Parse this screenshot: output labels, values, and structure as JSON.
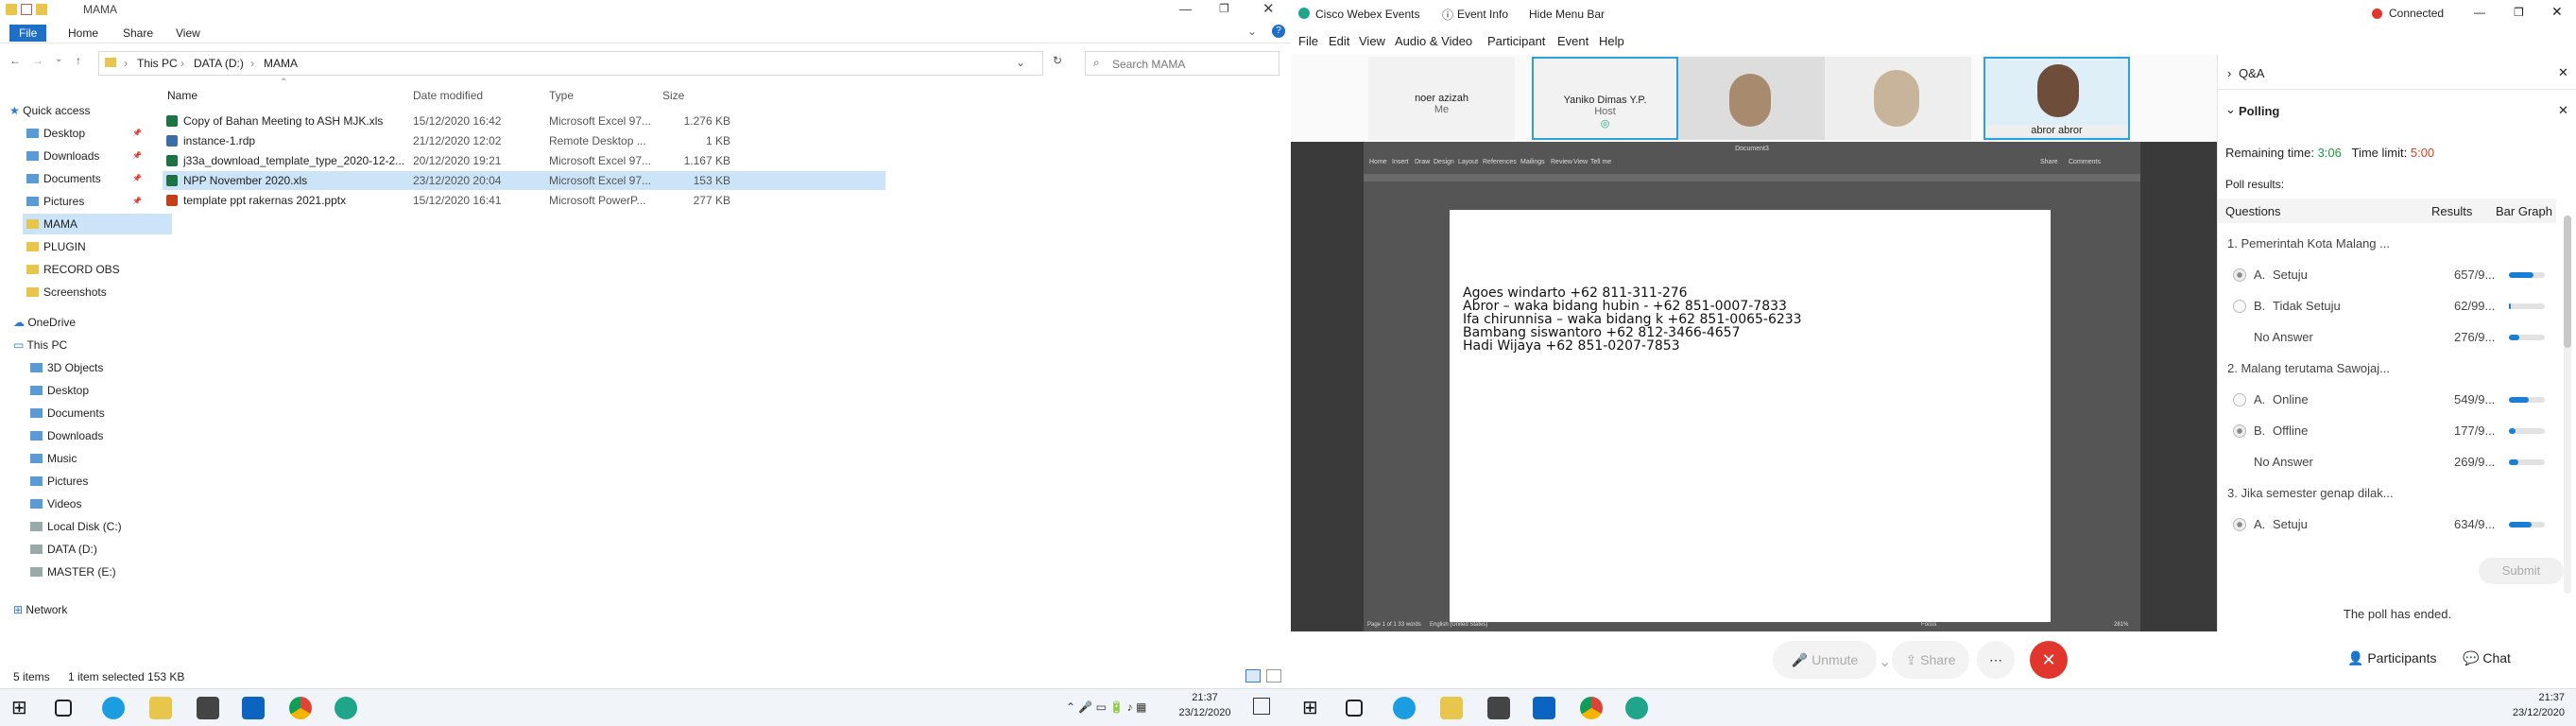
{
  "explorer": {
    "title": "MAMA",
    "ribbon_tabs": [
      "File",
      "Home",
      "Share",
      "View"
    ],
    "breadcrumb": [
      "This PC",
      "DATA (D:)",
      "MAMA"
    ],
    "search_placeholder": "Search MAMA",
    "columns": [
      "Name",
      "Date modified",
      "Type",
      "Size"
    ],
    "nav": {
      "quick_access": "Quick access",
      "quick_items": [
        "Desktop",
        "Downloads",
        "Documents",
        "Pictures",
        "MAMA",
        "PLUGIN",
        "RECORD OBS",
        "Screenshots"
      ],
      "onedrive": "OneDrive",
      "this_pc": "This PC",
      "pc_items": [
        "3D Objects",
        "Desktop",
        "Documents",
        "Downloads",
        "Music",
        "Pictures",
        "Videos",
        "Local Disk (C:)",
        "DATA (D:)",
        "MASTER (E:)"
      ],
      "network": "Network"
    },
    "files": [
      {
        "name": "Copy of Bahan Meeting to ASH MJK.xls",
        "date": "15/12/2020 16:42",
        "type": "Microsoft Excel 97...",
        "size": "1.276 KB",
        "icon": "excel-icon",
        "color": "#1f7244"
      },
      {
        "name": "instance-1.rdp",
        "date": "21/12/2020 12:02",
        "type": "Remote Desktop ...",
        "size": "1 KB",
        "icon": "rdp-icon",
        "color": "#3a6ea5"
      },
      {
        "name": "j33a_download_template_type_2020-12-2...",
        "date": "20/12/2020 19:21",
        "type": "Microsoft Excel 97...",
        "size": "1.167 KB",
        "icon": "excel-icon",
        "color": "#1f7244"
      },
      {
        "name": "NPP November 2020.xls",
        "date": "23/12/2020 20:04",
        "type": "Microsoft Excel 97...",
        "size": "153 KB",
        "icon": "excel-icon",
        "color": "#1f7244"
      },
      {
        "name": "template ppt rakernas 2021.pptx",
        "date": "15/12/2020 16:41",
        "type": "Microsoft PowerP...",
        "size": "277 KB",
        "icon": "powerpoint-icon",
        "color": "#c43e1c"
      }
    ],
    "status": {
      "items": "5 items",
      "selected": "1 item selected  153 KB"
    }
  },
  "webex": {
    "app_title": "Cisco Webex Events",
    "event_info": "Event Info",
    "hide_menu": "Hide Menu Bar",
    "connected": "Connected",
    "menu": [
      "File",
      "Edit",
      "View",
      "Audio & Video",
      "Participant",
      "Event",
      "Help"
    ],
    "participants": [
      {
        "name": "noer azizah",
        "role": "Me"
      },
      {
        "name": "Yaniko Dimas Y.P.",
        "role": "Host"
      },
      {
        "name": "abror abror",
        "role": ""
      }
    ],
    "word": {
      "doc_title": "Document3",
      "tabs": [
        "Home",
        "Insert",
        "Draw",
        "Design",
        "Layout",
        "References",
        "Mailings",
        "Review",
        "View",
        "Tell me"
      ],
      "share": "Share",
      "comments": "Comments",
      "status_left": "Page 1 of 1    33 words",
      "language": "English (United States)",
      "zoom": "281%",
      "focus": "Focus",
      "lines": [
        "Agoes windarto +62 811-311-276",
        "Abror – waka bidang hubin - +62 851-0007-7833",
        "Ifa chirunnisa – waka bidang k +62 851-0065-6233",
        "Bambang siswantoro +62 812-3466-4657",
        "Hadi Wijaya +62 851-0207-7853"
      ]
    },
    "controls": {
      "unmute": "Unmute",
      "share": "Share",
      "participants": "Participants",
      "chat": "Chat"
    },
    "panel": {
      "qa": "Q&A",
      "polling": "Polling",
      "remaining_label": "Remaining time:",
      "remaining": "3:06",
      "limit_label": "Time limit:",
      "limit": "5:00",
      "results_label": "Poll results:",
      "headers": [
        "Questions",
        "Results",
        "Bar Graph"
      ],
      "rows": [
        {
          "kind": "q",
          "text": "1.  Pemerintah Kota Malang ..."
        },
        {
          "kind": "a",
          "letter": "A.",
          "text": "Setuju",
          "result": "657/9...",
          "fill": 0.69,
          "checked": true
        },
        {
          "kind": "a",
          "letter": "B.",
          "text": "Tidak Setuju",
          "result": "62/99...",
          "fill": 0.06,
          "checked": false
        },
        {
          "kind": "n",
          "text": "No Answer",
          "result": "276/9...",
          "fill": 0.28
        },
        {
          "kind": "q",
          "text": "2.  Malang terutama Sawojaj..."
        },
        {
          "kind": "a",
          "letter": "A.",
          "text": "Online",
          "result": "549/9...",
          "fill": 0.55,
          "checked": false
        },
        {
          "kind": "a",
          "letter": "B.",
          "text": "Offline",
          "result": "177/9...",
          "fill": 0.18,
          "checked": true
        },
        {
          "kind": "n",
          "text": "No Answer",
          "result": "269/9...",
          "fill": 0.27
        },
        {
          "kind": "q",
          "text": "3.  Jika semester genap dilak..."
        },
        {
          "kind": "a",
          "letter": "A.",
          "text": "Setuju",
          "result": "634/9...",
          "fill": 0.64,
          "checked": true
        }
      ],
      "submit": "Submit",
      "ended": "The poll has ended."
    }
  },
  "taskbar": {
    "time": "21:37",
    "date": "23/12/2020"
  }
}
